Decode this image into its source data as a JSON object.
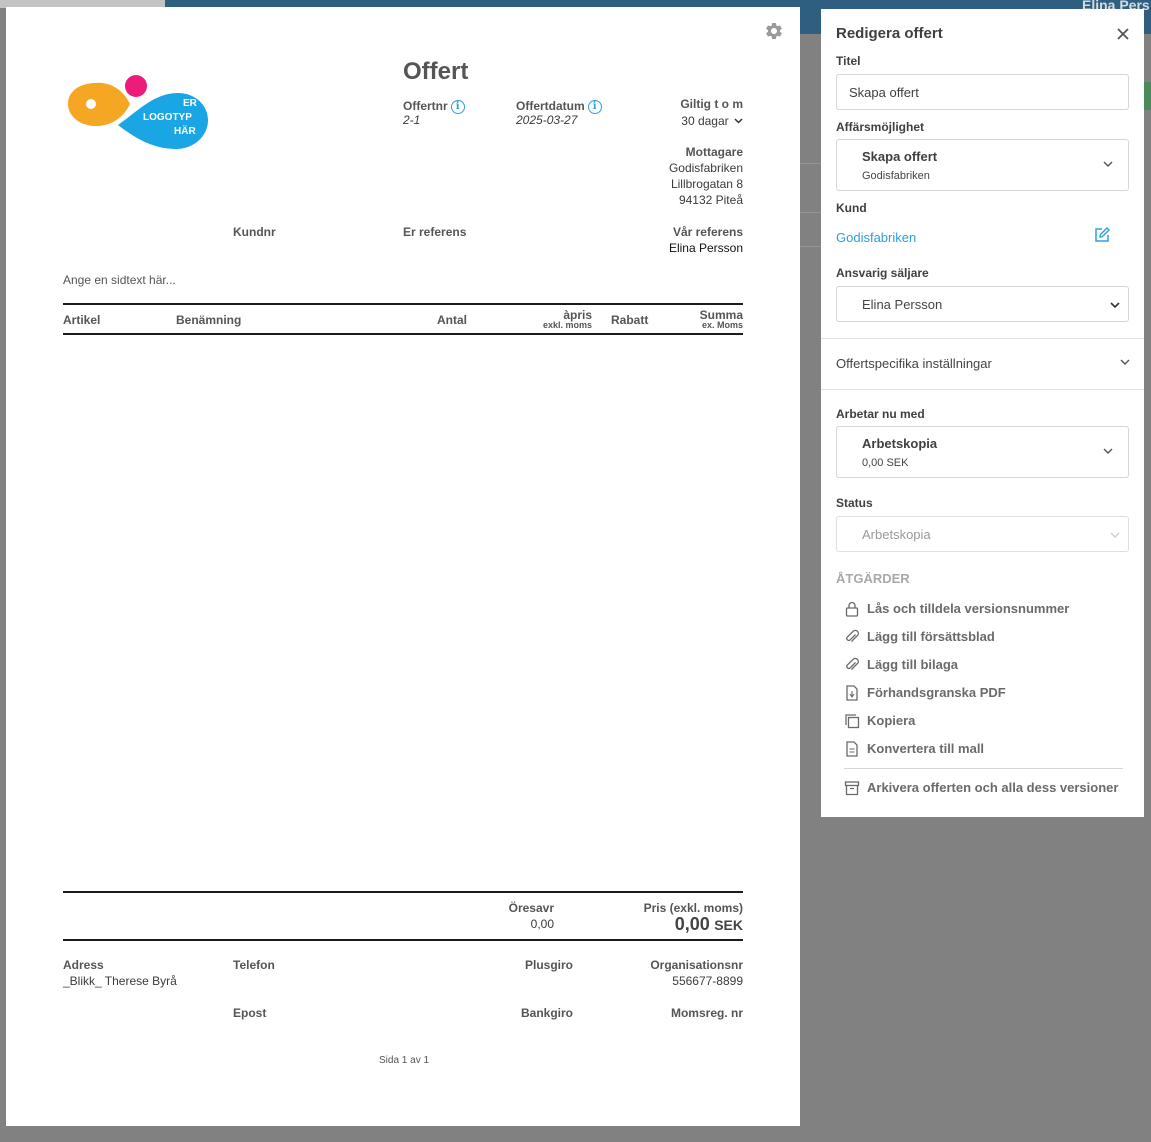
{
  "background": {
    "user_name": "Elina Pers"
  },
  "document": {
    "logo_text": [
      "ER",
      "LOGOTYP",
      "HÄR"
    ],
    "title": "Offert",
    "offertnr_label": "Offertnr",
    "offertnr_value": "2-1",
    "offertdatum_label": "Offertdatum",
    "offertdatum_value": "2025-03-27",
    "giltig_label": "Giltig t o m",
    "giltig_value": "30 dagar",
    "mottagare_label": "Mottagare",
    "mottagare_lines": [
      "Godisfabriken",
      "Lillbrogatan 8",
      "94132 Piteå"
    ],
    "kundnr_label": "Kundnr",
    "er_referens_label": "Er referens",
    "var_referens_label": "Vår referens",
    "var_referens_value": "Elina Persson",
    "sidtext_placeholder": "Ange en sidtext här...",
    "table_headers": {
      "artikel": "Artikel",
      "benamning": "Benämning",
      "antal": "Antal",
      "apris": "àpris",
      "apris_sub": "exkl. moms",
      "rabatt": "Rabatt",
      "summa": "Summa",
      "summa_sub": "ex. Moms"
    },
    "totals": {
      "oresavr_label": "Öresavr",
      "oresavr_value": "0,00",
      "pris_label": "Pris (exkl. moms)",
      "pris_value": "0,00",
      "currency": "SEK"
    },
    "footer": {
      "adress_label": "Adress",
      "adress_value": "_Blikk_ Therese Byrå",
      "telefon_label": "Telefon",
      "plusgiro_label": "Plusgiro",
      "orgnr_label": "Organisationsnr",
      "orgnr_value": "556677-8899",
      "epost_label": "Epost",
      "bankgiro_label": "Bankgiro",
      "momsreg_label": "Momsreg. nr",
      "page_info": "Sida 1 av 1"
    }
  },
  "panel": {
    "title": "Redigera offert",
    "titel_label": "Titel",
    "titel_value": "Skapa offert",
    "affarsmojlighet_label": "Affärsmöjlighet",
    "affarsmojlighet_main": "Skapa offert",
    "affarsmojlighet_sub": "Godisfabriken",
    "kund_label": "Kund",
    "kund_value": "Godisfabriken",
    "saljare_label": "Ansvarig säljare",
    "saljare_value": "Elina Persson",
    "settings_label": "Offertspecifika inställningar",
    "arbetar_label": "Arbetar nu med",
    "arbetar_main": "Arbetskopia",
    "arbetar_sub": "0,00 SEK",
    "status_label": "Status",
    "status_value": "Arbetskopia",
    "actions_heading": "ÅTGÄRDER",
    "actions": [
      "Lås och tilldela versionsnummer",
      "Lägg till försättsblad",
      "Lägg till bilaga",
      "Förhandsgranska PDF",
      "Kopiera",
      "Konvertera till mall"
    ],
    "archive_label": "Arkivera offerten och alla dess versioner"
  },
  "colors": {
    "accent_blue": "#2f9fdc",
    "logo_orange": "#f5a623",
    "logo_pink": "#ec1c7c",
    "logo_blue": "#1aa6e4",
    "topbar": "#2f5f80"
  }
}
